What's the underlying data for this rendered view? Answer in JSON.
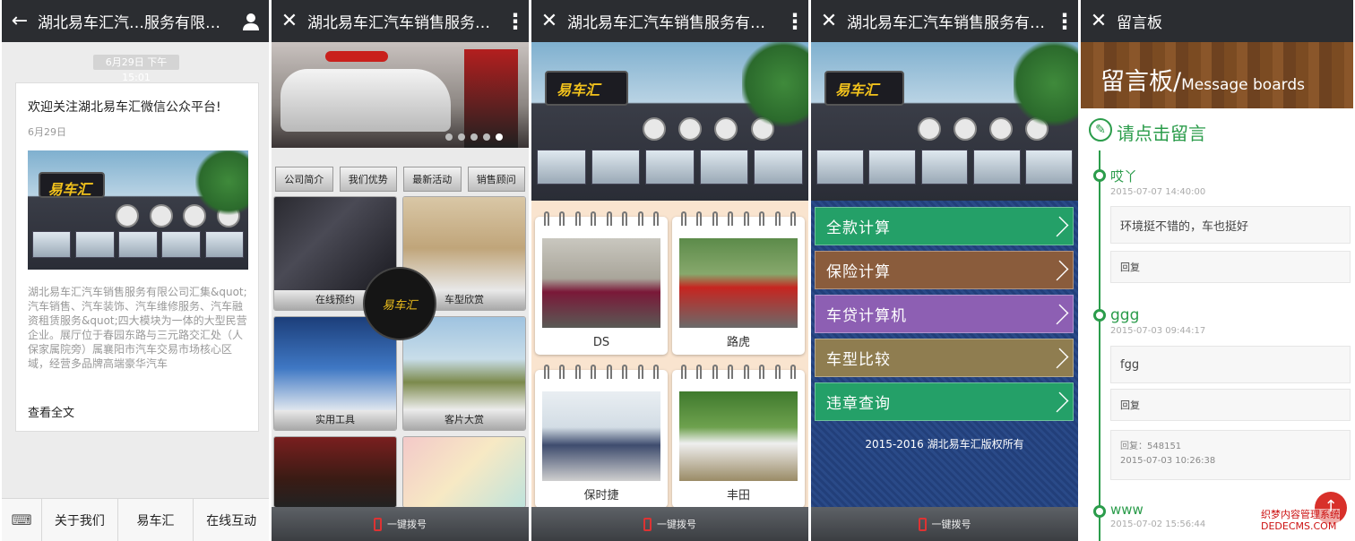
{
  "colors": {
    "green_accent": "#2b9c4b",
    "topbar": "#2b2d31",
    "brand_yellow": "#f2c21c"
  },
  "screen1": {
    "title": "湖北易车汇汽…服务有限公司",
    "date_chip": "6月29日 下午15:01",
    "article_title": "欢迎关注湖北易车汇微信公众平台!",
    "article_date": "6月29日",
    "sign_text": "易车汇",
    "article_excerpt": "湖北易车汇汽车销售服务有限公司汇集&quot;汽车销售、汽车装饰、汽车维修服务、汽车融资租赁服务&quot;四大模块为一体的大型民营企业。展厅位于春园东路与三元路交汇处（人保家属院旁）属襄阳市汽车交易市场核心区域，经营多品牌高端豪华汽车",
    "read_more": "查看全文",
    "menu": [
      "关于我们",
      "易车汇",
      "在线互动"
    ]
  },
  "screen2": {
    "title": "湖北易车汇汽车销售服务有…",
    "tabs": [
      "公司简介",
      "我们优势",
      "最新活动",
      "销售顾问"
    ],
    "tiles": [
      "在线预约",
      "车型欣赏",
      "实用工具",
      "客片大赏",
      "",
      ""
    ],
    "center_logo": "易车汇",
    "dial": "一键拨号"
  },
  "screen3": {
    "title": "湖北易车汇汽车销售服务有…",
    "cars": [
      "DS",
      "路虎",
      "保时捷",
      "丰田"
    ],
    "dial": "一键拨号",
    "sign_text": "易车汇"
  },
  "screen4": {
    "title": "湖北易车汇汽车销售服务有…",
    "buttons": [
      "全款计算",
      "保险计算",
      "车贷计算机",
      "车型比较",
      "违章查询"
    ],
    "copyright": "2015-2016 湖北易车汇版权所有",
    "dial": "一键拨号",
    "sign_text": "易车汇"
  },
  "screen5": {
    "title": "留言板",
    "banner_cn": "留言板/",
    "banner_en": "Message boards",
    "leave_message": "请点击留言",
    "entries": [
      {
        "name": "哎丫",
        "time": "2015-07-07 14:40:00",
        "text": "环境挺不错的，车也挺好",
        "reply": "回复"
      },
      {
        "name": "ggg",
        "time": "2015-07-03 09:44:17",
        "text": "fgg",
        "reply": "回复",
        "admin_reply": "回复：548151",
        "admin_time": "2015-07-03 10:26:38"
      },
      {
        "name": "www",
        "time": "2015-07-02 15:56:44"
      }
    ],
    "watermark1": "织梦内容管理系统",
    "watermark2": "DEDECMS.COM"
  }
}
